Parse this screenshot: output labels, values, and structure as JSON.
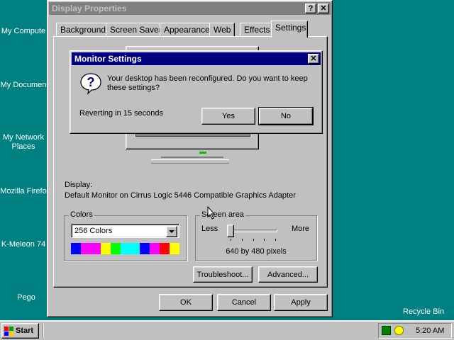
{
  "desktop": {
    "icons": [
      "My Compute",
      "My Documen",
      "My Network Places",
      "Mozilla Firefo",
      "K-Meleon 74",
      "Pego"
    ],
    "recycle_bin": "Recycle Bin"
  },
  "window": {
    "title": "Display Properties",
    "help_glyph": "?",
    "close_glyph": "✕",
    "tabs": [
      {
        "label": "Background"
      },
      {
        "label": "Screen Saver"
      },
      {
        "label": "Appearance"
      },
      {
        "label": "Web"
      },
      {
        "label": "Effects"
      },
      {
        "label": "Settings",
        "active": true
      }
    ],
    "settings": {
      "display_label": "Display:",
      "display_value": "Default Monitor on Cirrus Logic 5446 Compatible Graphics Adapter",
      "colors": {
        "label": "Colors",
        "selected": "256 Colors",
        "palette": [
          "#0000ff",
          "#ff00ff",
          "#ff00ff",
          "#ffff00",
          "#00ff00",
          "#00ffff",
          "#00ffff",
          "#0000ff",
          "#ff00ff",
          "#ff0000",
          "#ffff00"
        ]
      },
      "screen_area": {
        "label": "Screen area",
        "less": "Less",
        "more": "More",
        "value": "640 by 480 pixels",
        "slider_level": 0
      },
      "troubleshoot_label": "Troubleshoot...",
      "advanced_label": "Advanced..."
    },
    "buttons": {
      "ok": "OK",
      "cancel": "Cancel",
      "apply": "Apply"
    }
  },
  "dialog": {
    "title": "Monitor Settings",
    "close_glyph": "✕",
    "icon": "question-icon",
    "message": "Your desktop has been reconfigured.  Do you want to keep these settings?",
    "countdown": "Reverting in 15 seconds",
    "yes_label": "Yes",
    "no_label": "No"
  },
  "taskbar": {
    "start_label": "Start",
    "clock": "5:20 AM"
  }
}
